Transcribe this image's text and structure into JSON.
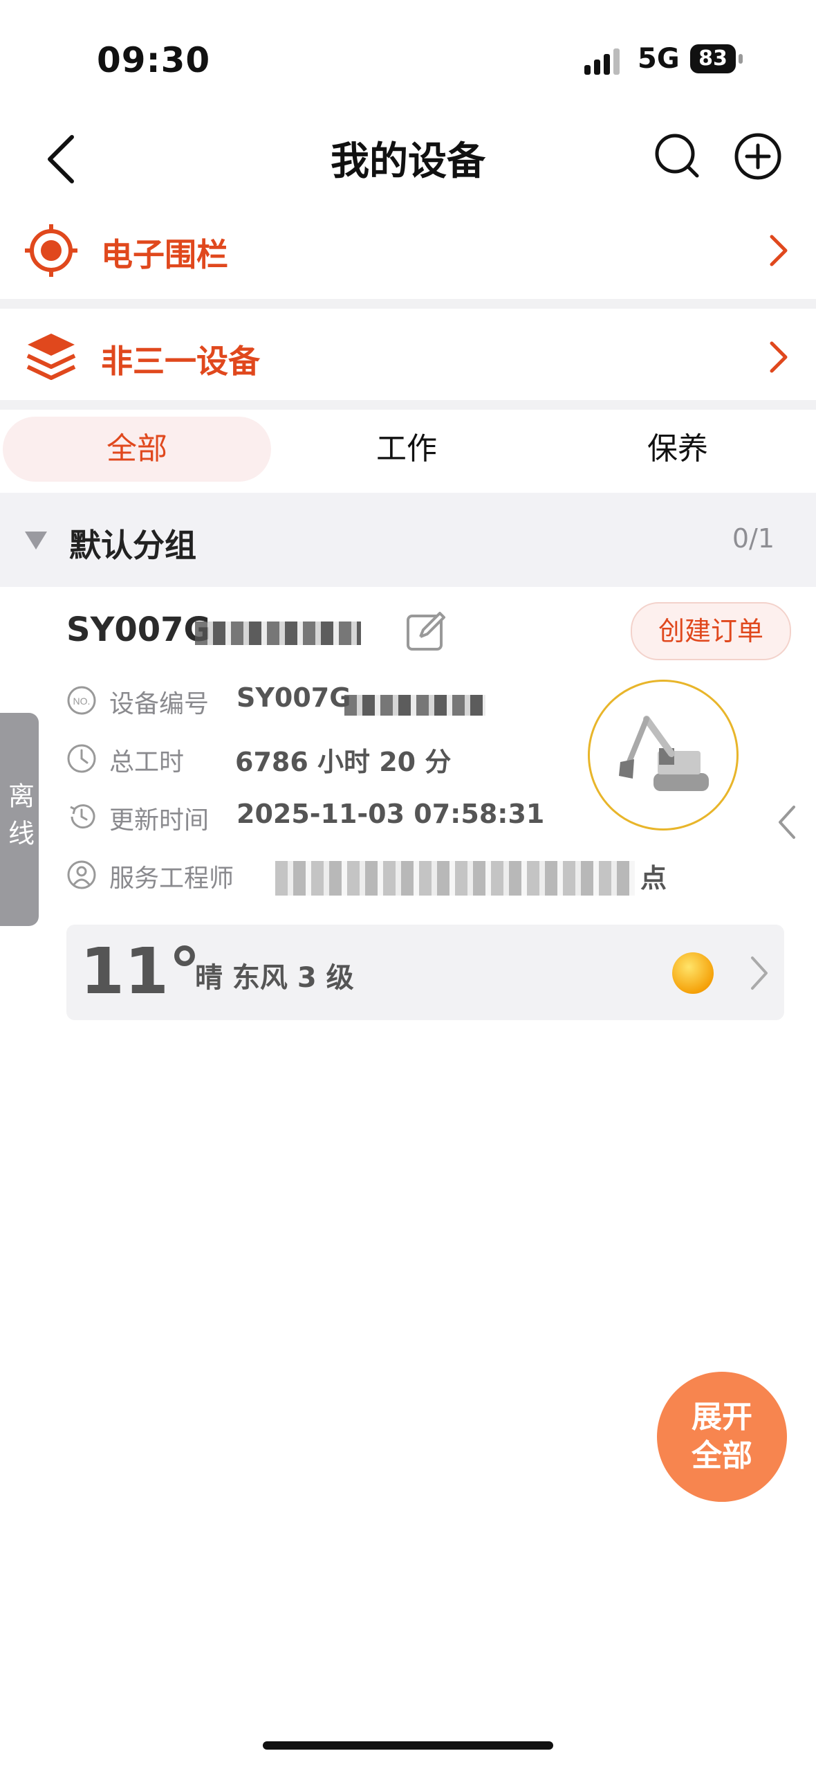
{
  "status_bar": {
    "time": "09:30",
    "network": "5G",
    "battery": "83"
  },
  "header": {
    "title": "我的设备"
  },
  "rows": [
    {
      "label": "电子围栏"
    },
    {
      "label": "非三一设备"
    }
  ],
  "tabs": [
    {
      "label": "全部",
      "active": true
    },
    {
      "label": "工作",
      "active": false
    },
    {
      "label": "保养",
      "active": false
    }
  ],
  "group": {
    "name": "默认分组",
    "count": "0/1"
  },
  "device": {
    "name": "SY007G",
    "create_order_label": "创建订单",
    "status": "离线",
    "fields": [
      {
        "label": "设备编号",
        "value": "SY007G"
      },
      {
        "label": "总工时",
        "value": "6786 小时 20 分"
      },
      {
        "label": "更新时间",
        "value": "2025-11-03 07:58:31"
      },
      {
        "label": "服务工程师",
        "value": "点"
      }
    ]
  },
  "weather": {
    "temp": "11°",
    "description": "晴  东风  3 级"
  },
  "fab": {
    "line1": "展开",
    "line2": "全部"
  },
  "colors": {
    "accent": "#e0481d",
    "fab": "#f7854f",
    "ring": "#e8b52a"
  }
}
